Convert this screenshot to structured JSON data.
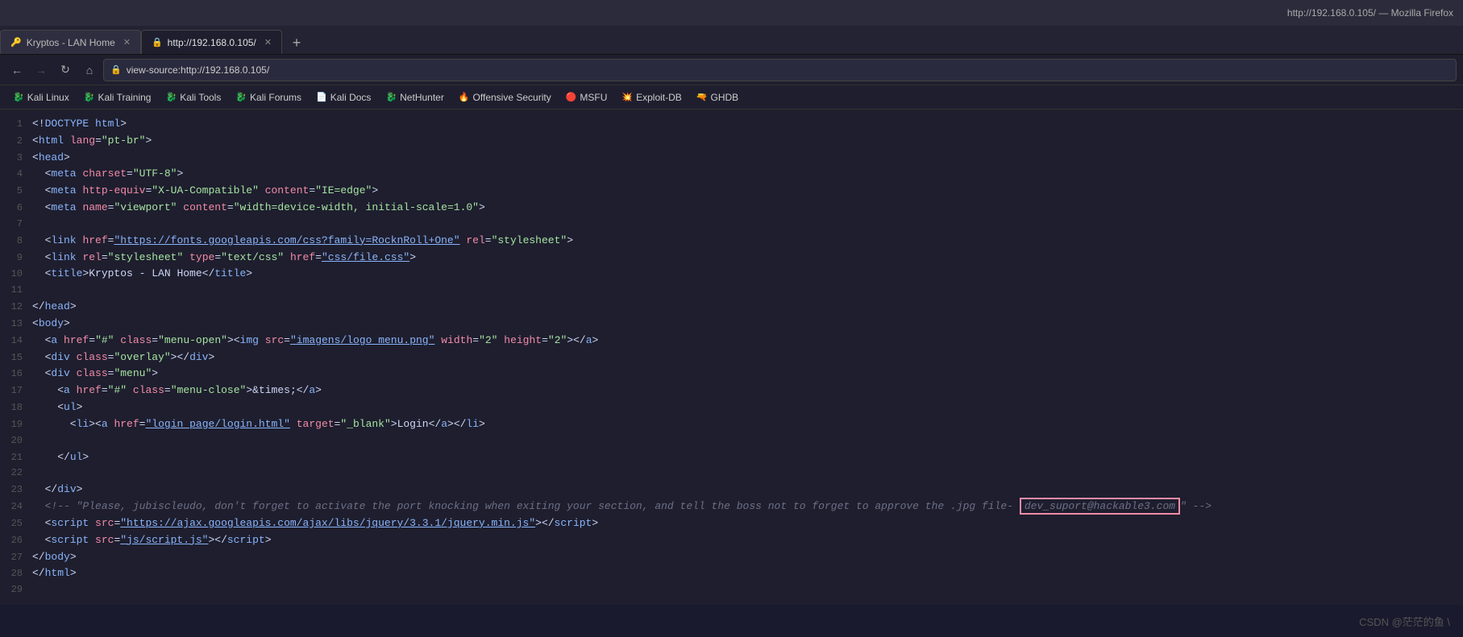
{
  "titlebar": {
    "text": "http://192.168.0.105/ — Mozilla Firefox"
  },
  "tabs": [
    {
      "id": "tab1",
      "label": "Kryptos - LAN Home",
      "active": false,
      "closeable": true
    },
    {
      "id": "tab2",
      "label": "http://192.168.0.105/",
      "active": true,
      "closeable": true
    }
  ],
  "tab_new_label": "+",
  "navbar": {
    "back_label": "←",
    "forward_label": "→",
    "reload_label": "↻",
    "home_label": "⌂",
    "address": "view-source:http://192.168.0.105/",
    "lock_icon": "🔒"
  },
  "bookmarks": [
    {
      "id": "bm1",
      "icon": "🐉",
      "label": "Kali Linux"
    },
    {
      "id": "bm2",
      "icon": "🐉",
      "label": "Kali Training"
    },
    {
      "id": "bm3",
      "icon": "🐉",
      "label": "Kali Tools"
    },
    {
      "id": "bm4",
      "icon": "🐉",
      "label": "Kali Forums"
    },
    {
      "id": "bm5",
      "icon": "📄",
      "label": "Kali Docs"
    },
    {
      "id": "bm6",
      "icon": "🐉",
      "label": "NetHunter"
    },
    {
      "id": "bm7",
      "icon": "🔥",
      "label": "Offensive Security"
    },
    {
      "id": "bm8",
      "icon": "🔴",
      "label": "MSFU"
    },
    {
      "id": "bm9",
      "icon": "💥",
      "label": "Exploit-DB"
    },
    {
      "id": "bm10",
      "icon": "🔫",
      "label": "GHDB"
    }
  ],
  "source_lines": [
    {
      "num": 1,
      "html": "<span class='plain'>&lt;!<span class='kw'>DOCTYPE html</span>&gt;</span>"
    },
    {
      "num": 2,
      "html": "<span class='plain'>&lt;<span class='kw'>html</span> <span class='attr'>lang</span>=<span class='val'>\"pt-br\"</span>&gt;</span>"
    },
    {
      "num": 3,
      "html": "<span class='plain'>&lt;<span class='kw'>head</span>&gt;</span>"
    },
    {
      "num": 4,
      "html": "<span class='plain'>  &lt;<span class='kw'>meta</span> <span class='attr'>charset</span>=<span class='val'>\"UTF-8\"</span>&gt;</span>"
    },
    {
      "num": 5,
      "html": "<span class='plain'>  &lt;<span class='kw'>meta</span> <span class='attr'>http-equiv</span>=<span class='val'>\"X-UA-Compatible\"</span> <span class='attr'>content</span>=<span class='val'>\"IE=edge\"</span>&gt;</span>"
    },
    {
      "num": 6,
      "html": "<span class='plain'>  &lt;<span class='kw'>meta</span> <span class='attr'>name</span>=<span class='val'>\"viewport\"</span> <span class='attr'>content</span>=<span class='val'>\"width=device-width, initial-scale=1.0\"</span>&gt;</span>"
    },
    {
      "num": 7,
      "html": ""
    },
    {
      "num": 8,
      "html": "<span class='plain'>  &lt;<span class='kw'>link</span> <span class='attr'>href</span>=<span class='val'><span class='url'>\"https://fonts.googleapis.com/css?family=RocknRoll+One\"</span></span> <span class='attr'>rel</span>=<span class='val'>\"stylesheet\"</span>&gt;</span>"
    },
    {
      "num": 9,
      "html": "<span class='plain'>  &lt;<span class='kw'>link</span> <span class='attr'>rel</span>=<span class='val'>\"stylesheet\"</span> <span class='attr'>type</span>=<span class='val'>\"text/css\"</span> <span class='attr'>href</span>=<span class='val'><span class='url'>\"css/file.css\"</span></span>&gt;</span>"
    },
    {
      "num": 10,
      "html": "<span class='plain'>  &lt;<span class='kw'>title</span>&gt;Kryptos - LAN Home&lt;/<span class='kw'>title</span>&gt;</span>"
    },
    {
      "num": 11,
      "html": ""
    },
    {
      "num": 12,
      "html": "<span class='plain'>&lt;/<span class='kw'>head</span>&gt;</span>"
    },
    {
      "num": 13,
      "html": "<span class='plain'>&lt;<span class='kw'>body</span>&gt;</span>"
    },
    {
      "num": 14,
      "html": "<span class='plain'>  &lt;<span class='kw'>a</span> <span class='attr'>href</span>=<span class='val'>\"#\"</span> <span class='attr'>class</span>=<span class='val'>\"menu-open\"</span>&gt;&lt;<span class='kw'>img</span> <span class='attr'>src</span>=<span class='val'><span class='url'>\"imagens/logo_menu.png\"</span></span> <span class='attr'>width</span>=<span class='val'>\"2\"</span> <span class='attr'>height</span>=<span class='val'>\"2\"</span>&gt;&lt;/<span class='kw'>a</span>&gt;</span>"
    },
    {
      "num": 15,
      "html": "<span class='plain'>  &lt;<span class='kw'>div</span> <span class='attr'>class</span>=<span class='val'>\"overlay\"</span>&gt;&lt;/<span class='kw'>div</span>&gt;</span>"
    },
    {
      "num": 16,
      "html": "<span class='plain'>  &lt;<span class='kw'>div</span> <span class='attr'>class</span>=<span class='val'>\"menu\"</span>&gt;</span>"
    },
    {
      "num": 17,
      "html": "<span class='plain'>    &lt;<span class='kw'>a</span> <span class='attr'>href</span>=<span class='val'>\"#\"</span> <span class='attr'>class</span>=<span class='val'>\"menu-close\"</span>&gt;&amp;times;&lt;/<span class='kw'>a</span>&gt;</span>"
    },
    {
      "num": 18,
      "html": "<span class='plain'>    &lt;<span class='kw'>ul</span>&gt;</span>"
    },
    {
      "num": 19,
      "html": "<span class='plain'>      &lt;<span class='kw'>li</span>&gt;&lt;<span class='kw'>a</span> <span class='attr'>href</span>=<span class='val'><span class='url'>\"login_page/login.html\"</span></span> <span class='attr'>target</span>=<span class='val'>\"_blank\"</span>&gt;Login&lt;/<span class='kw'>a</span>&gt;&lt;/<span class='kw'>li</span>&gt;</span>"
    },
    {
      "num": 20,
      "html": ""
    },
    {
      "num": 21,
      "html": "<span class='plain'>    &lt;/<span class='kw'>ul</span>&gt;</span>"
    },
    {
      "num": 22,
      "html": ""
    },
    {
      "num": 23,
      "html": "<span class='plain'>  &lt;/<span class='kw'>div</span>&gt;</span>"
    },
    {
      "num": 24,
      "html": "<span class='plain'>  <span class='cm'>&lt;!-- \"Please, jubiscleudo, don't forget to activate the port knocking when exiting your section, and tell the boss not to forget to approve the .jpg file- <span class='highlight-box' style='border:2px solid #f38ba8;'>dev_suport@hackable3.com</span>\" --&gt;</span></span>"
    },
    {
      "num": 25,
      "html": "<span class='plain'>  &lt;<span class='kw'>script</span> <span class='attr'>src</span>=<span class='val'><span class='url'>\"https://ajax.googleapis.com/ajax/libs/jquery/3.3.1/jquery.min.js\"</span></span>&gt;&lt;/<span class='kw'>script</span>&gt;</span>"
    },
    {
      "num": 26,
      "html": "<span class='plain'>  &lt;<span class='kw'>script</span> <span class='attr'>src</span>=<span class='val'><span class='url'>\"js/script.js\"</span></span>&gt;&lt;/<span class='kw'>script</span>&gt;</span>"
    },
    {
      "num": 27,
      "html": "<span class='plain'>&lt;/<span class='kw'>body</span>&gt;</span>"
    },
    {
      "num": 28,
      "html": "<span class='plain'>&lt;/<span class='kw'>html</span>&gt;</span>"
    },
    {
      "num": 29,
      "html": ""
    }
  ],
  "footer": {
    "watermark": "CSDN @茫茫的鱼 \\"
  }
}
